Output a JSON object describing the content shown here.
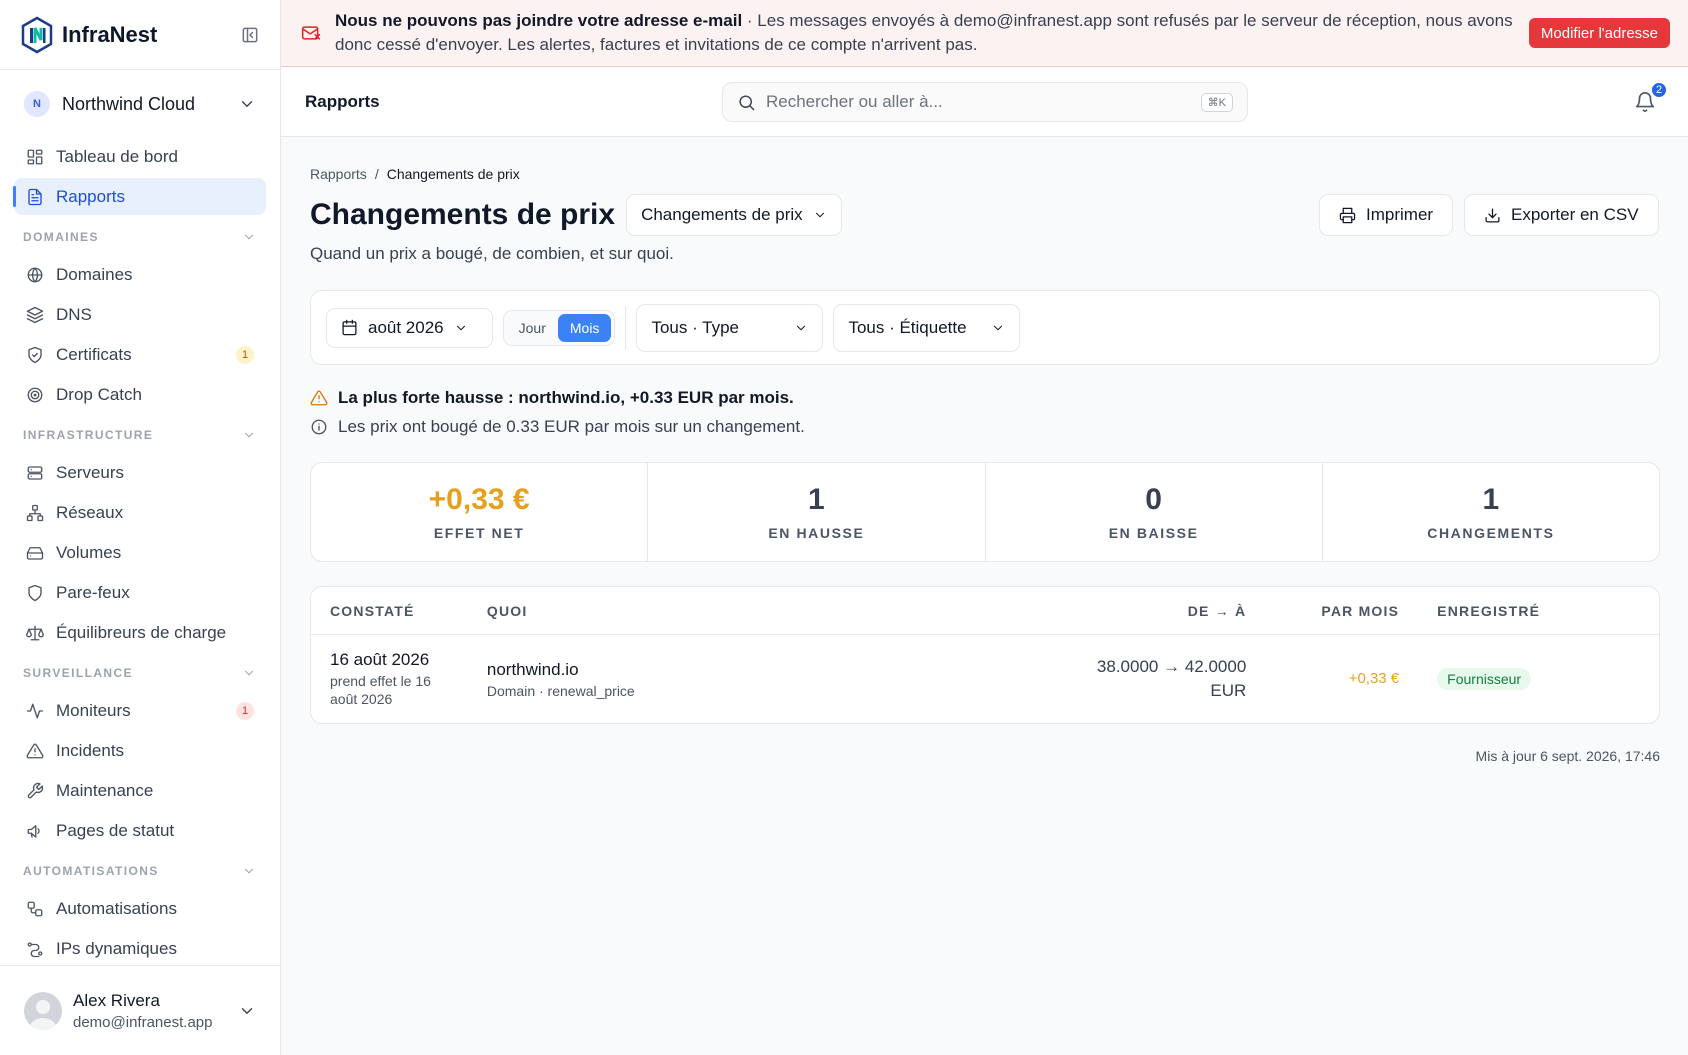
{
  "brand": {
    "name": "InfraNest"
  },
  "org": {
    "initial": "N",
    "name": "Northwind Cloud"
  },
  "nav": {
    "top": [
      {
        "label": "Tableau de bord",
        "icon": "dashboard-icon"
      },
      {
        "label": "Rapports",
        "icon": "report-icon",
        "active": true
      }
    ],
    "sections": [
      {
        "title": "DOMAINES",
        "items": [
          {
            "label": "Domaines",
            "icon": "globe-icon"
          },
          {
            "label": "DNS",
            "icon": "layers-icon"
          },
          {
            "label": "Certificats",
            "icon": "shield-check-icon",
            "badge": "1"
          },
          {
            "label": "Drop Catch",
            "icon": "target-icon"
          }
        ]
      },
      {
        "title": "INFRASTRUCTURE",
        "items": [
          {
            "label": "Serveurs",
            "icon": "server-icon"
          },
          {
            "label": "Réseaux",
            "icon": "network-icon"
          },
          {
            "label": "Volumes",
            "icon": "hard-drive-icon"
          },
          {
            "label": "Pare-feux",
            "icon": "shield-icon"
          },
          {
            "label": "Équilibreurs de charge",
            "icon": "scale-icon"
          }
        ]
      },
      {
        "title": "SURVEILLANCE",
        "items": [
          {
            "label": "Moniteurs",
            "icon": "activity-icon",
            "badge": "1"
          },
          {
            "label": "Incidents",
            "icon": "alert-triangle-icon"
          },
          {
            "label": "Maintenance",
            "icon": "wrench-icon"
          },
          {
            "label": "Pages de statut",
            "icon": "megaphone-icon"
          }
        ]
      },
      {
        "title": "AUTOMATISATIONS",
        "items": [
          {
            "label": "Automatisations",
            "icon": "workflow-icon"
          },
          {
            "label": "IPs dynamiques",
            "icon": "dynamic-ip-icon"
          }
        ]
      }
    ]
  },
  "user": {
    "name": "Alex Rivera",
    "email": "demo@infranest.app"
  },
  "banner": {
    "title": "Nous ne pouvons pas joindre votre adresse e-mail",
    "message": " · Les messages envoyés à demo@infranest.app sont refusés par le serveur de réception, nous avons donc cessé d'envoyer. Les alertes, factures et invitations de ce compte n'arrivent pas.",
    "button": "Modifier l'adresse"
  },
  "topbar": {
    "title": "Rapports",
    "search_placeholder": "Rechercher ou aller à...",
    "shortcut": "⌘K",
    "notifications": "2"
  },
  "page": {
    "breadcrumb": [
      "Rapports",
      "/",
      "Changements de prix"
    ],
    "title": "Changements de prix",
    "report_select": "Changements de prix",
    "subtitle": "Quand un prix a bougé, de combien, et sur quoi.",
    "print": "Imprimer",
    "export": "Exporter en CSV"
  },
  "filters": {
    "month": "août 2026",
    "granularity": [
      "Jour",
      "Mois"
    ],
    "granularity_selected": "Mois",
    "type": "Tous · Type",
    "tag": "Tous · Étiquette"
  },
  "alerts": {
    "warning": "La plus forte hausse : northwind.io, +0.33 EUR par mois.",
    "info": "Les prix ont bougé de 0.33 EUR par mois sur un changement."
  },
  "stats": [
    {
      "value": "+0,33 €",
      "label": "EFFET NET",
      "color": "#e5a11e"
    },
    {
      "value": "1",
      "label": "EN HAUSSE"
    },
    {
      "value": "0",
      "label": "EN BAISSE"
    },
    {
      "value": "1",
      "label": "CHANGEMENTS"
    }
  ],
  "table": {
    "headers": [
      "CONSTATÉ",
      "QUOI",
      "DE → À",
      "PAR MOIS",
      "ENREGISTRÉ"
    ],
    "rows": [
      {
        "date": "16 août 2026",
        "date_note": "prend effet le 16 août 2026",
        "what": "northwind.io",
        "what_sub": "Domain · renewal_price",
        "from_to": "38.0000 → 42.0000",
        "currency": "EUR",
        "per_month": "+0,33 €",
        "source": "Fournisseur"
      }
    ]
  },
  "updated": "Mis à jour 6 sept. 2026, 17:46"
}
